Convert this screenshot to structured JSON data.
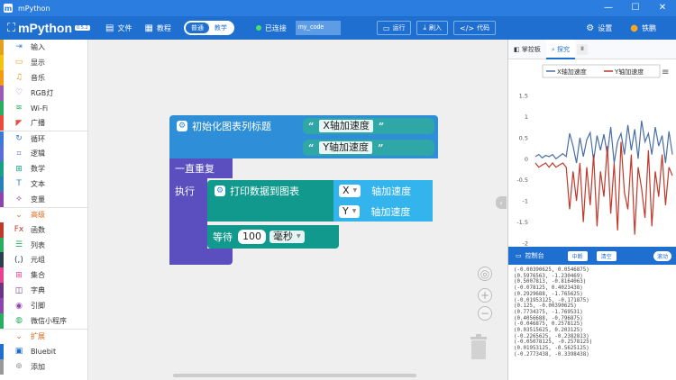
{
  "window": {
    "title": "mPython",
    "minimize": "—",
    "maximize": "☐",
    "close": "✕"
  },
  "menu": {
    "logo": "mPython",
    "version": "0.5.2",
    "file": "文件",
    "tutorial": "教程",
    "mode_normal": "普通",
    "mode_teach": "教学",
    "connected": "已连接",
    "filename": "my_code",
    "run": "运行",
    "flash": "刷入",
    "code": "代码",
    "settings": "设置",
    "user": "铁鹏"
  },
  "sidebar": {
    "items": [
      {
        "label": "输入",
        "color": "#e5a01c",
        "icon": "⇥",
        "icolor": "#3a7bd5",
        "type": "item"
      },
      {
        "label": "显示",
        "color": "#f1c40f",
        "icon": "▭",
        "icolor": "#e5a01c",
        "type": "item"
      },
      {
        "label": "音乐",
        "color": "#f39c12",
        "icon": "♫",
        "icolor": "#e5a01c",
        "type": "item"
      },
      {
        "label": "RGB灯",
        "color": "#9b59b6",
        "icon": "♡",
        "icolor": "#9b59b6",
        "type": "item"
      },
      {
        "label": "Wi-Fi",
        "color": "#27ae60",
        "icon": "≋",
        "icolor": "#27ae60",
        "type": "item"
      },
      {
        "label": "广播",
        "color": "#e74c3c",
        "icon": "◤",
        "icolor": "#e74c3c",
        "type": "item"
      },
      {
        "label": "循环",
        "color": "#3a7bd5",
        "icon": "↻",
        "icolor": "#3a7bd5",
        "type": "item",
        "sep": true
      },
      {
        "label": "逻辑",
        "color": "#5b6dd8",
        "icon": "⌗",
        "icolor": "#5b6dd8",
        "type": "item"
      },
      {
        "label": "数学",
        "color": "#16a085",
        "icon": "⊞",
        "icolor": "#16a085",
        "type": "item"
      },
      {
        "label": "文本",
        "color": "#2980b9",
        "icon": "T",
        "icolor": "#2980b9",
        "type": "item"
      },
      {
        "label": "变量",
        "color": "#8e44ad",
        "icon": "⟡",
        "icolor": "#8e44ad",
        "type": "item"
      },
      {
        "label": "高级",
        "color": "#ffffff",
        "icon": "⌄",
        "icolor": "#e0691c",
        "type": "head",
        "sep": true
      },
      {
        "label": "函数",
        "color": "#c0392b",
        "icon": "Fx",
        "icolor": "#c0392b",
        "type": "item"
      },
      {
        "label": "列表",
        "color": "#27ae60",
        "icon": "☰",
        "icolor": "#27ae60",
        "type": "item"
      },
      {
        "label": "元组",
        "color": "#2c3e50",
        "icon": "(,)",
        "icolor": "#2c3e50",
        "type": "item"
      },
      {
        "label": "集合",
        "color": "#e84393",
        "icon": "⊞",
        "icolor": "#e84393",
        "type": "item"
      },
      {
        "label": "字典",
        "color": "#6c3483",
        "icon": "◫",
        "icolor": "#6c3483",
        "type": "item"
      },
      {
        "label": "引脚",
        "color": "#8e44ad",
        "icon": "◉",
        "icolor": "#8e44ad",
        "type": "item"
      },
      {
        "label": "微信小程序",
        "color": "#27ae60",
        "icon": "◍",
        "icolor": "#27ae60",
        "type": "item"
      },
      {
        "label": "扩展",
        "color": "#ffffff",
        "icon": "⌄",
        "icolor": "#e0691c",
        "type": "head",
        "sep": true
      },
      {
        "label": "Bluebit",
        "color": "#1f6fd1",
        "icon": "▣",
        "icolor": "#1f6fd1",
        "type": "item"
      },
      {
        "label": "添加",
        "color": "#999999",
        "icon": "⊕",
        "icolor": "#999999",
        "type": "item"
      }
    ]
  },
  "blocks": {
    "init_title": "初始化图表列标题",
    "x_label": "X轴加速度",
    "y_label": "Y轴加速度",
    "forever": "一直重复",
    "do": "执行",
    "print_chart": "打印数据到图表",
    "x_sel": "X",
    "y_sel": "Y",
    "x_accel": "轴加速度",
    "y_accel": "轴加速度",
    "wait": "等待",
    "wait_value": "100",
    "unit": "毫秒"
  },
  "right_panel": {
    "tab_panel": "掌控板",
    "tab_explore": "探究",
    "pause": "II",
    "console_title": "控制台",
    "console_btn1": "中断",
    "console_btn2": "清空",
    "console_toggle": "滚动",
    "console_lines": [
      "(-0.00390625, 0.0546875)",
      "(0.5976563, -1.230469)",
      "(0.5007813, -0.8164063)",
      "(-0.078125, 0.4023438)",
      "(0.2929688, -1.765625)",
      "(-0.01953125, -0.171875)",
      "(0.125, -0.00390625)",
      "(0.7734375, -1.769531)",
      "(0.4056688, -0.796875)",
      "(-0.046875, 0.2578125)",
      "(0.03515625, 0.203125)",
      "(-0.2265625, -0.2382813)",
      "(-0.05078125, -0.2578125)",
      "(0.01953125, -0.5625125)",
      "(-0.2773438, -0.3398438)"
    ]
  },
  "chart_data": {
    "type": "line",
    "title": "",
    "xlabel": "",
    "ylabel": "",
    "ylim": [
      -2,
      1.5
    ],
    "yticks": [
      "1.5",
      "1",
      "0.5",
      "0",
      "-0.5",
      "-1",
      "-1.5",
      "-2"
    ],
    "legend_position": "top",
    "series": [
      {
        "name": "X轴加速度",
        "color": "#4a6fa5",
        "values": [
          0.05,
          0.1,
          0.02,
          0.08,
          0.05,
          0.1,
          0.0,
          0.06,
          0.12,
          0.05,
          0.6,
          0.3,
          -0.1,
          0.5,
          0.05,
          0.45,
          0.62,
          -0.05,
          0.55,
          0.2,
          0.58,
          0.1,
          0.75,
          -0.1,
          0.4,
          0.6,
          0.1,
          0.8,
          0.2,
          0.7,
          0.0,
          0.9,
          0.4,
          0.6,
          0.1,
          0.75,
          0.3,
          0.55,
          -0.1,
          0.65,
          0.1
        ]
      },
      {
        "name": "Y轴加速度",
        "color": "#c0392b",
        "values": [
          -0.1,
          -0.2,
          -0.15,
          -0.1,
          -0.2,
          -0.1,
          -0.2,
          -0.15,
          -0.1,
          -0.2,
          -1.2,
          -0.3,
          -1.0,
          -0.1,
          -1.5,
          -0.2,
          -1.1,
          0.1,
          -1.6,
          -0.3,
          -0.9,
          0.3,
          -1.3,
          -0.1,
          -1.7,
          0.4,
          -0.8,
          -1.2,
          0.1,
          -1.8,
          -0.2,
          -0.7,
          -1.4,
          0.2,
          -1.6,
          -0.3,
          -0.9,
          0.1,
          -1.1,
          -0.2,
          -0.4
        ]
      }
    ]
  }
}
